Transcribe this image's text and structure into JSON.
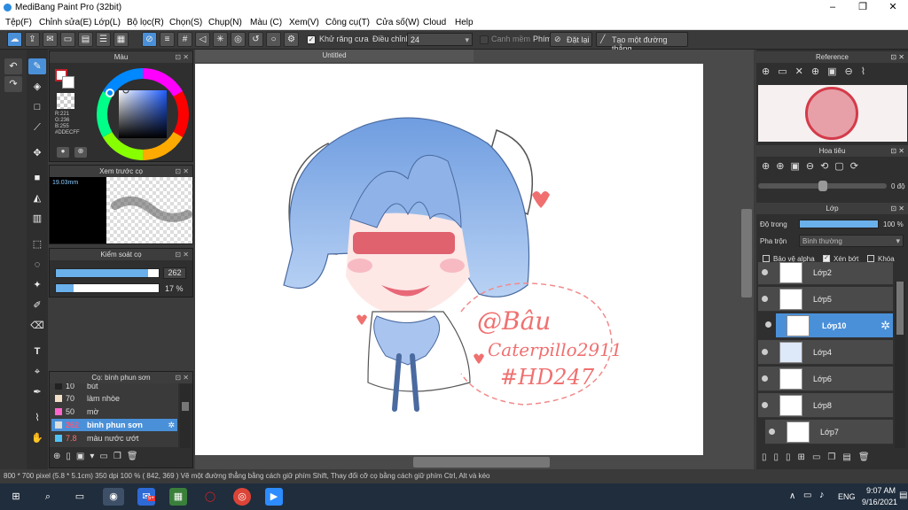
{
  "window": {
    "title": "MediBang Paint Pro (32bit)",
    "minimize": "–",
    "maximize": "❐",
    "close": "✕"
  },
  "menu": [
    "Tệp(F)",
    "Chỉnh sửa(E)",
    "Lớp(L)",
    "Bộ lọc(R)",
    "Chọn(S)",
    "Chụp(N)",
    "Màu (C)",
    "Xem(V)",
    "Công cụ(T)",
    "Cửa số(W)",
    "Cloud",
    "Help"
  ],
  "toolbar": {
    "antialias_label": "Khử răng cưa",
    "correction_label": "Điều chỉnh",
    "correction_value": "24",
    "canh_mem_label": "Canh mềm",
    "phim_label": "Phím",
    "reset_label": "Đặt lại",
    "line_label": "Tạo một đường thẳng"
  },
  "color_panel": {
    "title": "Màu",
    "rgb": "R:221\nG:236\nB:255\n#DDECFF",
    "r": "R:221",
    "g": "G:236",
    "b": "B:255",
    "hex": "#DDECFF"
  },
  "preview_panel": {
    "title": "Xem trước cọ",
    "size": "19.03mm"
  },
  "control_panel": {
    "title": "Kiểm soát cọ",
    "size_value": "262",
    "opacity_value": "17 %",
    "size_fraction": 0.9,
    "opacity_fraction": 0.17
  },
  "brush_panel": {
    "title": "Cọ: bình phun sơn",
    "items": [
      {
        "size": "10",
        "name": "bút",
        "color": "#222222"
      },
      {
        "size": "70",
        "name": "làm nhòe",
        "color": "#f2e0c8"
      },
      {
        "size": "50",
        "name": "mờ",
        "color": "#ff66cc"
      },
      {
        "size": "262",
        "name": "bình phun sơn",
        "color": "#dddddd"
      },
      {
        "size": "7.8",
        "name": "màu nước ướt",
        "color": "#4fc3f7"
      }
    ]
  },
  "document": {
    "tab": "Untitled"
  },
  "artwork": {
    "signature_line1": "@Bâu",
    "signature_line2": "Caterpillo2911",
    "signature_line3": "#HD247"
  },
  "reference_panel": {
    "title": "Reference"
  },
  "navigator_panel": {
    "title": "Hoa tiêu",
    "angle": "0 độ"
  },
  "layer_panel": {
    "title": "Lớp",
    "opacity_label": "Độ trong",
    "opacity_value": "100 %",
    "blend_label": "Pha trộn",
    "blend_value": "Bình thường",
    "protect_alpha": "Bảo vệ alpha",
    "clipping": "Xén bớt",
    "lock": "Khóa",
    "layers": [
      "Lớp2",
      "Lớp5",
      "Lớp10",
      "Lớp4",
      "Lớp6",
      "Lớp8",
      "Lớp7"
    ]
  },
  "status": "800 * 700 pixel   (5.8 * 5.1cm)   350 dpi   100 %   ( 842, 369 )   Vẽ một đường thẳng bằng cách giữ phím Shift, Thay đổi cỡ cọ bằng cách giữ phím Ctrl, Alt và kéo",
  "taskbar": {
    "lang": "ENG",
    "time": "9:07 AM",
    "date": "9/16/2021",
    "badge": "5+"
  },
  "colors": {
    "accent": "#4a90d9",
    "bg": "#3c3c3c",
    "panel": "#2f2f2f"
  }
}
